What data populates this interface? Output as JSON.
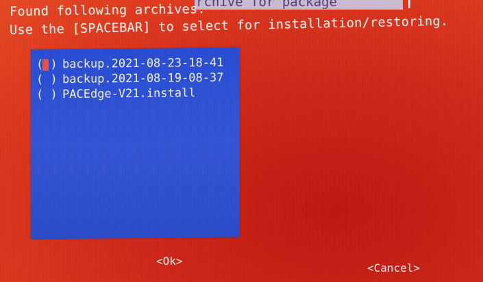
{
  "dialog": {
    "title_fragment": "rchive for package",
    "message_line1": "Found following archives.",
    "message_line2": "Use the [SPACEBAR] to select for installation/restoring."
  },
  "archives": [
    {
      "checkbox": "( )",
      "label": "backup.2021-08-23-18-41",
      "selected": false,
      "focused": true
    },
    {
      "checkbox": "( )",
      "label": "backup.2021-08-19-08-37",
      "selected": false,
      "focused": false
    },
    {
      "checkbox": "( )",
      "label": "PACEdge-V21.install",
      "selected": false,
      "focused": false
    }
  ],
  "buttons": {
    "ok_label": "<Ok>",
    "cancel_label": "<Cancel>"
  },
  "colors": {
    "background": "#d42d1c",
    "list_background": "#3052d4",
    "text": "#f3e8e6",
    "cursor": "#e0524c"
  }
}
